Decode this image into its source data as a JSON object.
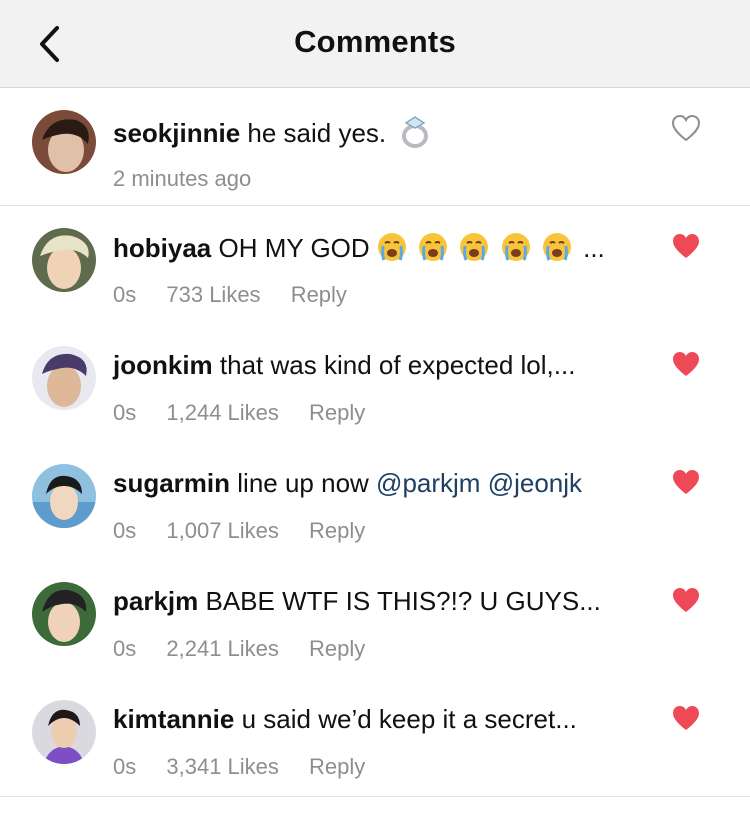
{
  "header": {
    "title": "Comments"
  },
  "caption": {
    "username": "seokjinnie",
    "text": "he said yes.",
    "time": "2 minutes ago",
    "colors": {
      "bg": "#7b4b3a",
      "face": "#e0c0a8",
      "hair": "#2a1a14"
    }
  },
  "comments": [
    {
      "username": "hobiyaa",
      "text": "OH MY GOD",
      "trail": "...",
      "emoji_count": 5,
      "time": "0s",
      "likes": "733 Likes",
      "reply": "Reply",
      "colors": {
        "bg": "#5e6b4c",
        "face": "#f0d2b6",
        "hair": "#e8e2c8"
      }
    },
    {
      "username": "joonkim",
      "text": "that was kind of expected lol,...",
      "time": "0s",
      "likes": "1,244 Likes",
      "reply": "Reply",
      "colors": {
        "bg": "#e8e8f0",
        "face": "#ddb899",
        "hair": "#4a3a6a"
      }
    },
    {
      "username": "sugarmin",
      "text": "line up now",
      "mention1": "@parkjm",
      "mention2": "@jeonjk",
      "time": "0s",
      "likes": "1,007 Likes",
      "reply": "Reply",
      "colors": {
        "bg": "#8fc0e0",
        "face": "#f0d8c0",
        "hair": "#1a1a1a"
      }
    },
    {
      "username": "parkjm",
      "text": "BABE WTF IS THIS?!? U GUYS...",
      "time": "0s",
      "likes": "2,241 Likes",
      "reply": "Reply",
      "colors": {
        "bg": "#3d6a3a",
        "face": "#f0d2b8",
        "hair": "#222222"
      }
    },
    {
      "username": "kimtannie",
      "text": "u said we’d keep it a secret...",
      "time": "0s",
      "likes": "3,341 Likes",
      "reply": "Reply",
      "colors": {
        "bg": "#d9d9df",
        "face": "#edcdb0",
        "hair": "#201818"
      }
    }
  ],
  "colors": {
    "heart_liked": "#ed4956",
    "meta_gray": "#8e8e8e",
    "mention": "#1e3f63"
  }
}
